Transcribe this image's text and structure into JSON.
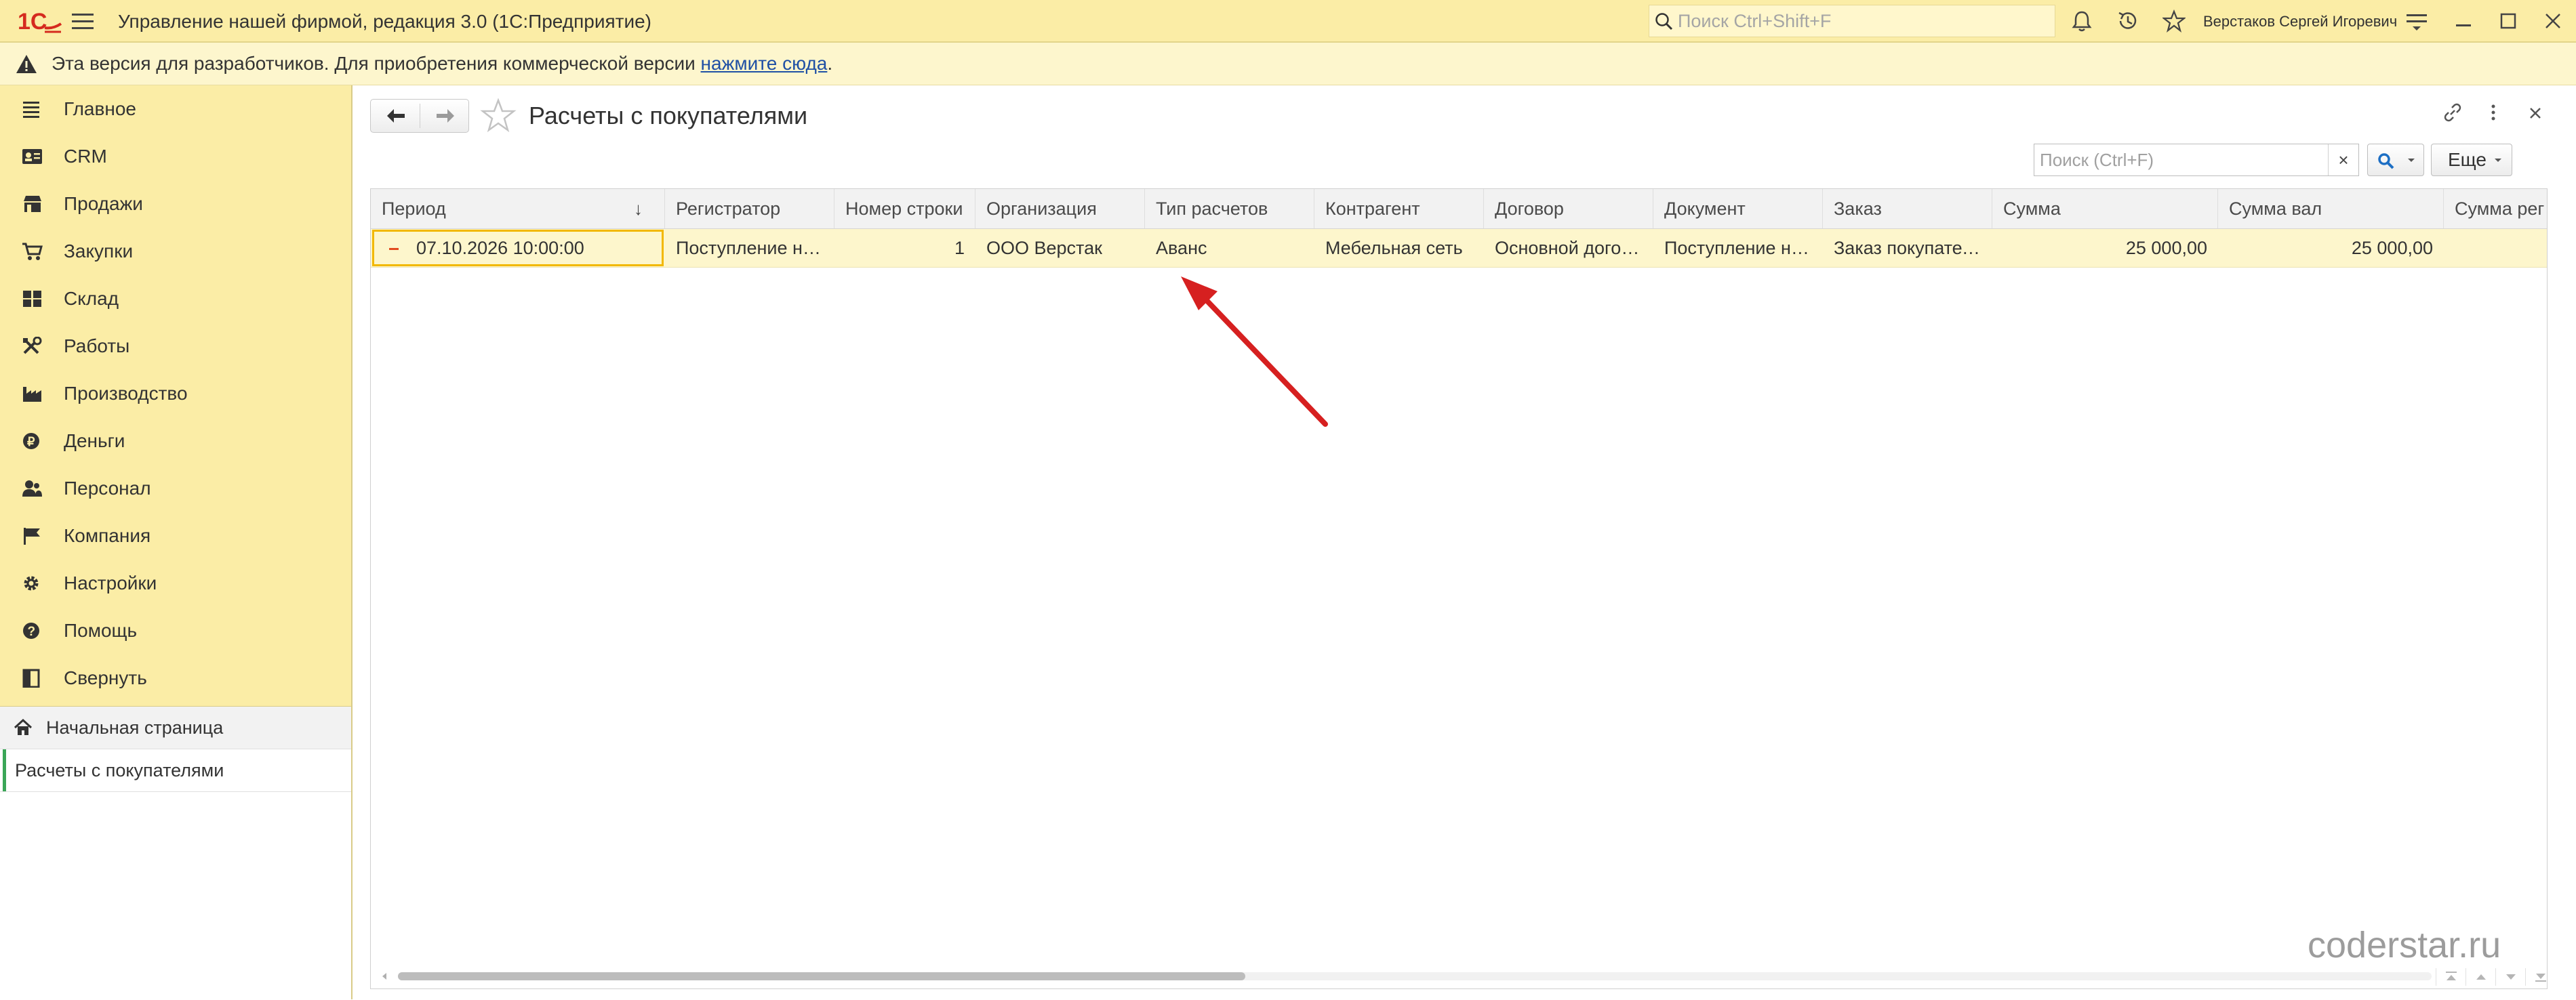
{
  "app": {
    "title": "Управление нашей фирмой, редакция 3.0  (1С:Предприятие)",
    "search_placeholder": "Поиск Ctrl+Shift+F",
    "user": "Верстаков Сергей Игоревич",
    "logo_text": "1С"
  },
  "notice": {
    "text": "Эта версия для разработчиков. Для приобретения коммерческой версии ",
    "link": "нажмите сюда",
    "suffix": "."
  },
  "sidebar": {
    "items": [
      {
        "label": "Главное",
        "icon": "list-icon"
      },
      {
        "label": "CRM",
        "icon": "crm-card-icon"
      },
      {
        "label": "Продажи",
        "icon": "shop-icon"
      },
      {
        "label": "Закупки",
        "icon": "cart-icon"
      },
      {
        "label": "Склад",
        "icon": "warehouse-grid-icon"
      },
      {
        "label": "Работы",
        "icon": "tools-icon"
      },
      {
        "label": "Производство",
        "icon": "factory-icon"
      },
      {
        "label": "Деньги",
        "icon": "ruble-coin-icon"
      },
      {
        "label": "Персонал",
        "icon": "people-icon"
      },
      {
        "label": "Компания",
        "icon": "flag-icon"
      },
      {
        "label": "Настройки",
        "icon": "gear-icon"
      },
      {
        "label": "Помощь",
        "icon": "help-icon"
      },
      {
        "label": "Свернуть",
        "icon": "collapse-panel-icon"
      }
    ],
    "home": "Начальная страница",
    "open_window": "Расчеты с покупателями"
  },
  "form": {
    "title": "Расчеты с покупателями",
    "find_placeholder": "Поиск (Ctrl+F)",
    "find_clear": "×",
    "more": "Еще"
  },
  "table": {
    "columns": [
      "Период",
      "Регистратор",
      "Номер строки",
      "Организация",
      "Тип расчетов",
      "Контрагент",
      "Договор",
      "Документ",
      "Заказ",
      "Сумма",
      "Сумма вал",
      "Сумма рег"
    ],
    "sort_indicator": "↓",
    "rows": [
      {
        "period": "07.10.2026 10:00:00",
        "registrar": "Поступление на счет",
        "line_no": "1",
        "organization": "ООО Верстак",
        "settlement_type": "Аванс",
        "counterparty": "Мебельная сеть",
        "contract": "Основной договор",
        "document": "Поступление на счет",
        "order": "Заказ покупателя",
        "amount": "25 000,00",
        "amount_cur": "25 000,00",
        "amount_reg": ""
      }
    ]
  },
  "watermark": "coderstar.ru",
  "colors": {
    "panel_yellow": "#fbeda6",
    "selected_row": "#fdf6cc",
    "focus_border": "#f2b800",
    "annotation_arrow": "#d62020",
    "active_window": "#3aa657"
  }
}
